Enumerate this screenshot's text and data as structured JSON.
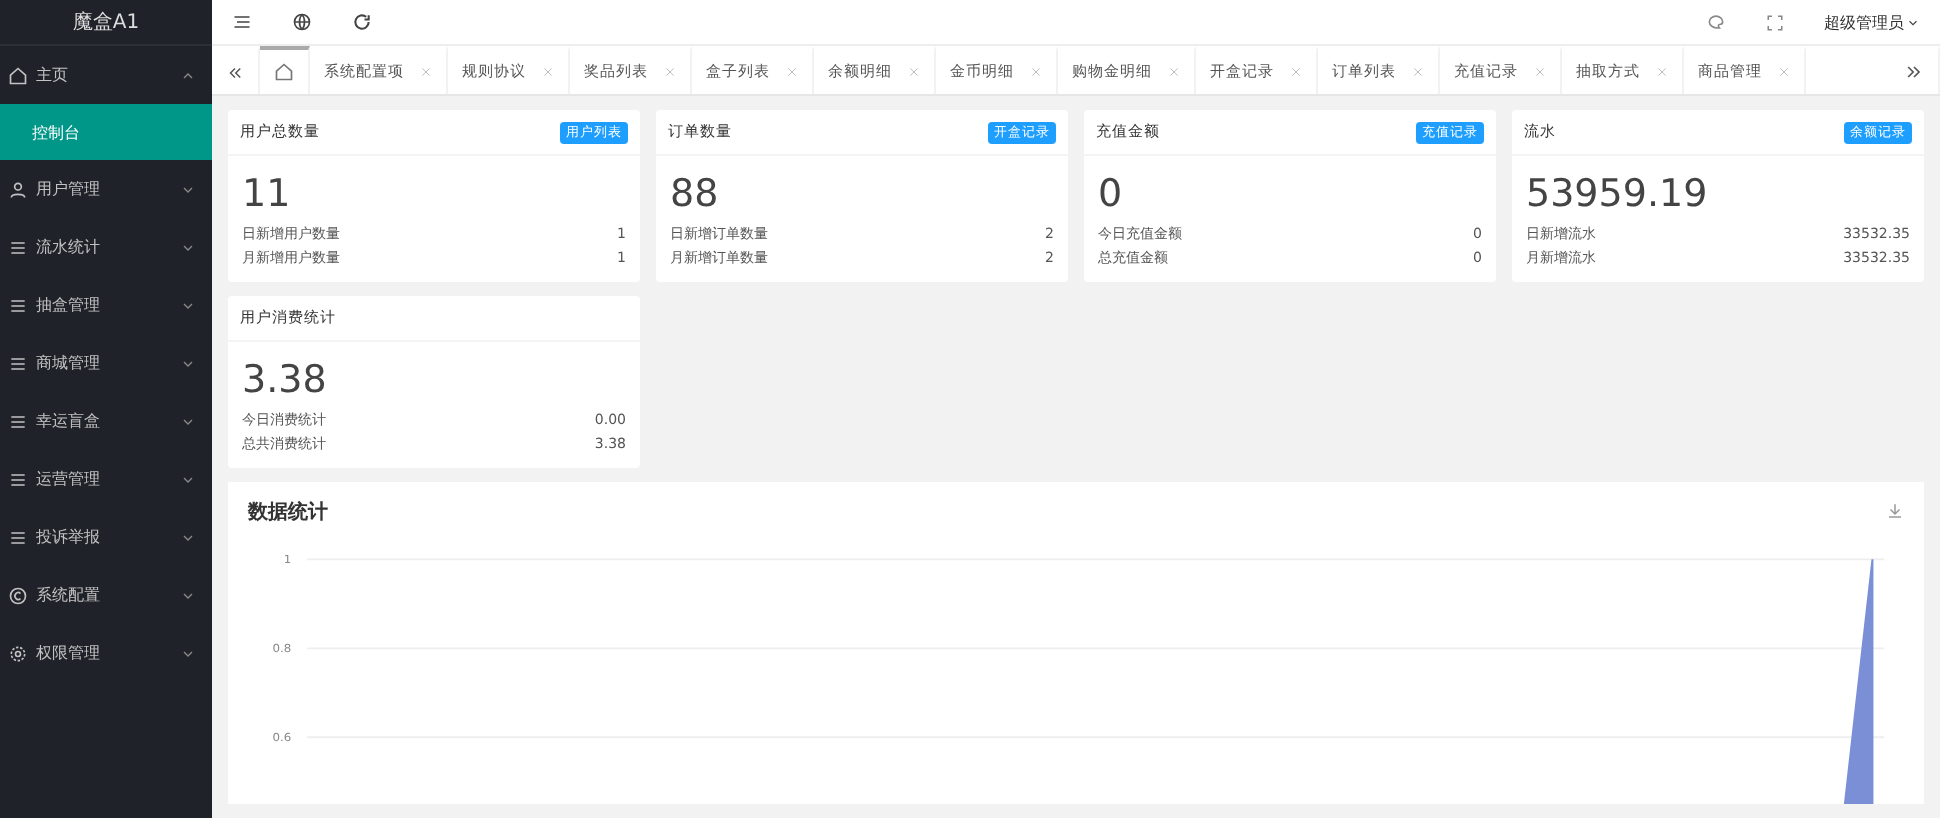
{
  "sidebar": {
    "logo": "魔盒A1",
    "items": [
      {
        "label": "主页",
        "expanded": true,
        "children": [
          {
            "label": "控制台",
            "selected": true
          }
        ]
      },
      {
        "label": "用户管理",
        "expanded": false
      },
      {
        "label": "流水统计",
        "expanded": false
      },
      {
        "label": "抽盒管理",
        "expanded": false
      },
      {
        "label": "商城管理",
        "expanded": false
      },
      {
        "label": "幸运盲盒",
        "expanded": false
      },
      {
        "label": "运营管理",
        "expanded": false
      },
      {
        "label": "投诉举报",
        "expanded": false
      },
      {
        "label": "系统配置",
        "expanded": false
      },
      {
        "label": "权限管理",
        "expanded": false
      }
    ]
  },
  "header": {
    "user": "超级管理员"
  },
  "tabs": [
    {
      "kind": "home",
      "selected": true
    },
    {
      "label": "系统配置项",
      "kind": "page",
      "selected": false
    },
    {
      "label": "规则协议",
      "kind": "page",
      "selected": false
    },
    {
      "label": "奖品列表",
      "kind": "page",
      "selected": false
    },
    {
      "label": "盒子列表",
      "kind": "page",
      "selected": false
    },
    {
      "label": "余额明细",
      "kind": "page",
      "selected": false
    },
    {
      "label": "金币明细",
      "kind": "page",
      "selected": false
    },
    {
      "label": "购物金明细",
      "kind": "page",
      "selected": false
    },
    {
      "label": "开盒记录",
      "kind": "page",
      "selected": false
    },
    {
      "label": "订单列表",
      "kind": "page",
      "selected": false
    },
    {
      "label": "充值记录",
      "kind": "page",
      "selected": false
    },
    {
      "label": "抽取方式",
      "kind": "page",
      "selected": false
    },
    {
      "label": "商品管理",
      "kind": "page",
      "selected": false
    }
  ],
  "cards": [
    {
      "title": "用户总数量",
      "badge": "用户列表",
      "value": "11",
      "rows": [
        {
          "label": "日新增用户数量",
          "value": "1"
        },
        {
          "label": "月新增用户数量",
          "value": "1"
        }
      ]
    },
    {
      "title": "订单数量",
      "badge": "开盒记录",
      "value": "88",
      "rows": [
        {
          "label": "日新增订单数量",
          "value": "2"
        },
        {
          "label": "月新增订单数量",
          "value": "2"
        }
      ]
    },
    {
      "title": "充值金额",
      "badge": "充值记录",
      "value": "0",
      "rows": [
        {
          "label": "今日充值金额",
          "value": "0"
        },
        {
          "label": "总充值金额",
          "value": "0"
        }
      ]
    },
    {
      "title": "流水",
      "badge": "余额记录",
      "value": "53959.19",
      "rows": [
        {
          "label": "日新增流水",
          "value": "33532.35"
        },
        {
          "label": "月新增流水",
          "value": "33532.35"
        }
      ]
    },
    {
      "title": "用户消费统计",
      "value": "3.38",
      "rows": [
        {
          "label": "今日消费统计",
          "value": "0.00"
        },
        {
          "label": "总共消费统计",
          "value": "3.38"
        }
      ]
    }
  ],
  "stats": {
    "title": "数据统计",
    "axis_labels": [
      "1",
      "0.8",
      "0.6"
    ]
  }
}
